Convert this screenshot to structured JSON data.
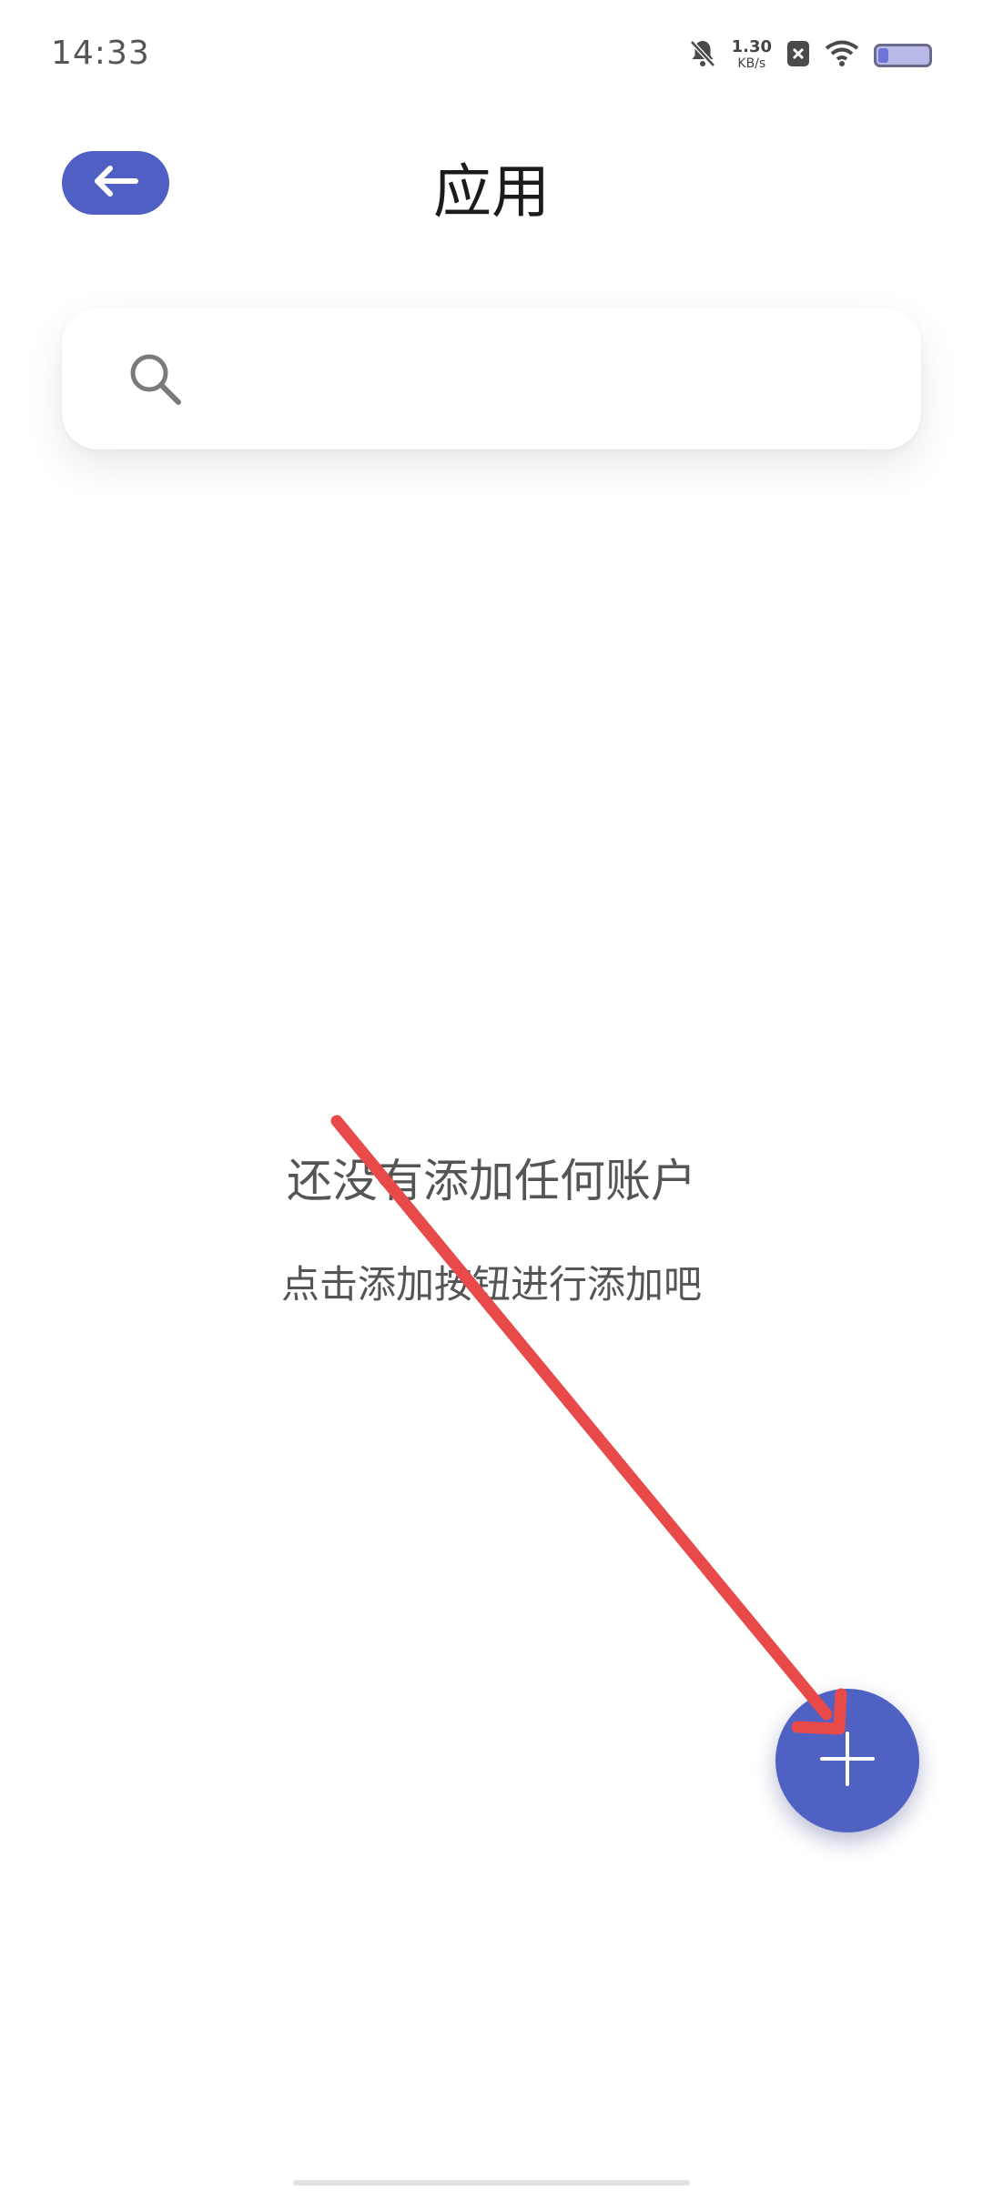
{
  "status_bar": {
    "time": "14:33",
    "net_speed_value": "1.30",
    "net_speed_unit": "KB/s",
    "icons": [
      "bell-muted-icon",
      "sim-blocked-icon",
      "wifi-icon",
      "battery-icon"
    ],
    "battery_level": 0.2
  },
  "header": {
    "back_icon": "arrow-left-icon",
    "title": "应用"
  },
  "search": {
    "icon": "search-icon",
    "value": "",
    "placeholder": ""
  },
  "empty_state": {
    "title": "还没有添加任何账户",
    "subtitle": "点击添加按钮进行添加吧"
  },
  "fab": {
    "icon": "plus-icon"
  },
  "annotation": {
    "type": "arrow",
    "color": "#e84a4a"
  },
  "colors": {
    "accent": "#4f5fc4",
    "text_primary": "#1b1b1b",
    "text_secondary": "#555555",
    "background": "#ffffff"
  }
}
